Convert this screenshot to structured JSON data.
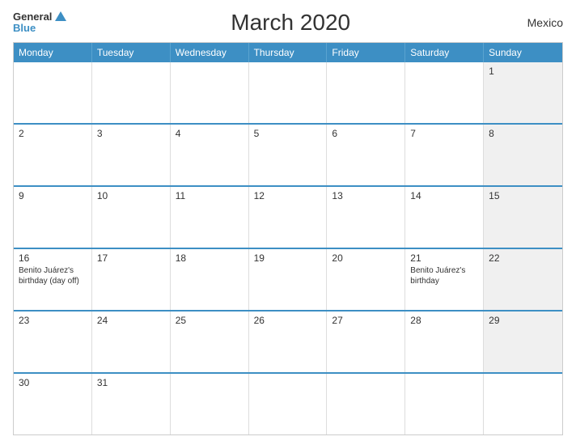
{
  "header": {
    "title": "March 2020",
    "country": "Mexico",
    "logo": {
      "general": "General",
      "blue": "Blue"
    }
  },
  "days_of_week": [
    "Monday",
    "Tuesday",
    "Wednesday",
    "Thursday",
    "Friday",
    "Saturday",
    "Sunday"
  ],
  "weeks": [
    [
      {
        "num": "",
        "event": "",
        "shaded": false
      },
      {
        "num": "",
        "event": "",
        "shaded": false
      },
      {
        "num": "",
        "event": "",
        "shaded": false
      },
      {
        "num": "",
        "event": "",
        "shaded": false
      },
      {
        "num": "",
        "event": "",
        "shaded": false
      },
      {
        "num": "",
        "event": "",
        "shaded": false
      },
      {
        "num": "1",
        "event": "",
        "shaded": true
      }
    ],
    [
      {
        "num": "2",
        "event": "",
        "shaded": false
      },
      {
        "num": "3",
        "event": "",
        "shaded": false
      },
      {
        "num": "4",
        "event": "",
        "shaded": false
      },
      {
        "num": "5",
        "event": "",
        "shaded": false
      },
      {
        "num": "6",
        "event": "",
        "shaded": false
      },
      {
        "num": "7",
        "event": "",
        "shaded": false
      },
      {
        "num": "8",
        "event": "",
        "shaded": true
      }
    ],
    [
      {
        "num": "9",
        "event": "",
        "shaded": false
      },
      {
        "num": "10",
        "event": "",
        "shaded": false
      },
      {
        "num": "11",
        "event": "",
        "shaded": false
      },
      {
        "num": "12",
        "event": "",
        "shaded": false
      },
      {
        "num": "13",
        "event": "",
        "shaded": false
      },
      {
        "num": "14",
        "event": "",
        "shaded": false
      },
      {
        "num": "15",
        "event": "",
        "shaded": true
      }
    ],
    [
      {
        "num": "16",
        "event": "Benito Juárez's birthday (day off)",
        "shaded": false
      },
      {
        "num": "17",
        "event": "",
        "shaded": false
      },
      {
        "num": "18",
        "event": "",
        "shaded": false
      },
      {
        "num": "19",
        "event": "",
        "shaded": false
      },
      {
        "num": "20",
        "event": "",
        "shaded": false
      },
      {
        "num": "21",
        "event": "Benito Juárez's birthday",
        "shaded": false
      },
      {
        "num": "22",
        "event": "",
        "shaded": true
      }
    ],
    [
      {
        "num": "23",
        "event": "",
        "shaded": false
      },
      {
        "num": "24",
        "event": "",
        "shaded": false
      },
      {
        "num": "25",
        "event": "",
        "shaded": false
      },
      {
        "num": "26",
        "event": "",
        "shaded": false
      },
      {
        "num": "27",
        "event": "",
        "shaded": false
      },
      {
        "num": "28",
        "event": "",
        "shaded": false
      },
      {
        "num": "29",
        "event": "",
        "shaded": true
      }
    ],
    [
      {
        "num": "30",
        "event": "",
        "shaded": false
      },
      {
        "num": "31",
        "event": "",
        "shaded": false
      },
      {
        "num": "",
        "event": "",
        "shaded": false
      },
      {
        "num": "",
        "event": "",
        "shaded": false
      },
      {
        "num": "",
        "event": "",
        "shaded": false
      },
      {
        "num": "",
        "event": "",
        "shaded": false
      },
      {
        "num": "",
        "event": "",
        "shaded": false
      }
    ]
  ]
}
